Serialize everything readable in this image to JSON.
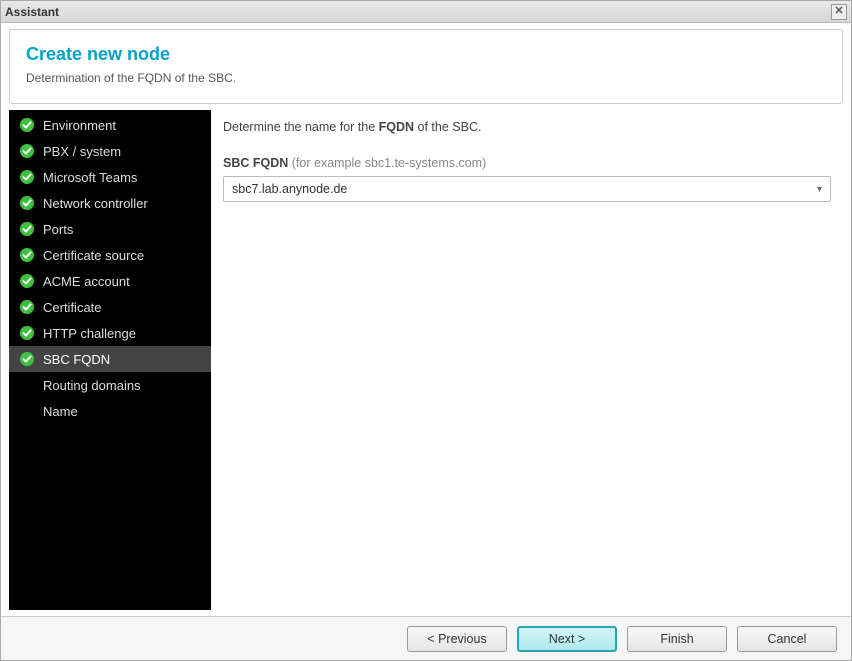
{
  "window": {
    "title": "Assistant"
  },
  "header": {
    "title": "Create new node",
    "subtitle": "Determination of the FQDN of the SBC."
  },
  "sidebar": {
    "steps": [
      {
        "label": "Environment",
        "done": true
      },
      {
        "label": "PBX / system",
        "done": true
      },
      {
        "label": "Microsoft Teams",
        "done": true
      },
      {
        "label": "Network controller",
        "done": true
      },
      {
        "label": "Ports",
        "done": true
      },
      {
        "label": "Certificate source",
        "done": true
      },
      {
        "label": "ACME account",
        "done": true
      },
      {
        "label": "Certificate",
        "done": true
      },
      {
        "label": "HTTP challenge",
        "done": true
      },
      {
        "label": "SBC FQDN",
        "done": true,
        "selected": true
      },
      {
        "label": "Routing domains",
        "done": false
      },
      {
        "label": "Name",
        "done": false
      }
    ]
  },
  "content": {
    "instruction_pre": "Determine the name for the ",
    "instruction_bold": "FQDN",
    "instruction_post": " of the SBC.",
    "field_label_strong": "SBC FQDN",
    "field_label_hint": "(for example sbc1.te-systems.com)",
    "dropdown_value": "sbc7.lab.anynode.de"
  },
  "footer": {
    "previous": "< Previous",
    "next": "Next >",
    "finish": "Finish",
    "cancel": "Cancel"
  }
}
